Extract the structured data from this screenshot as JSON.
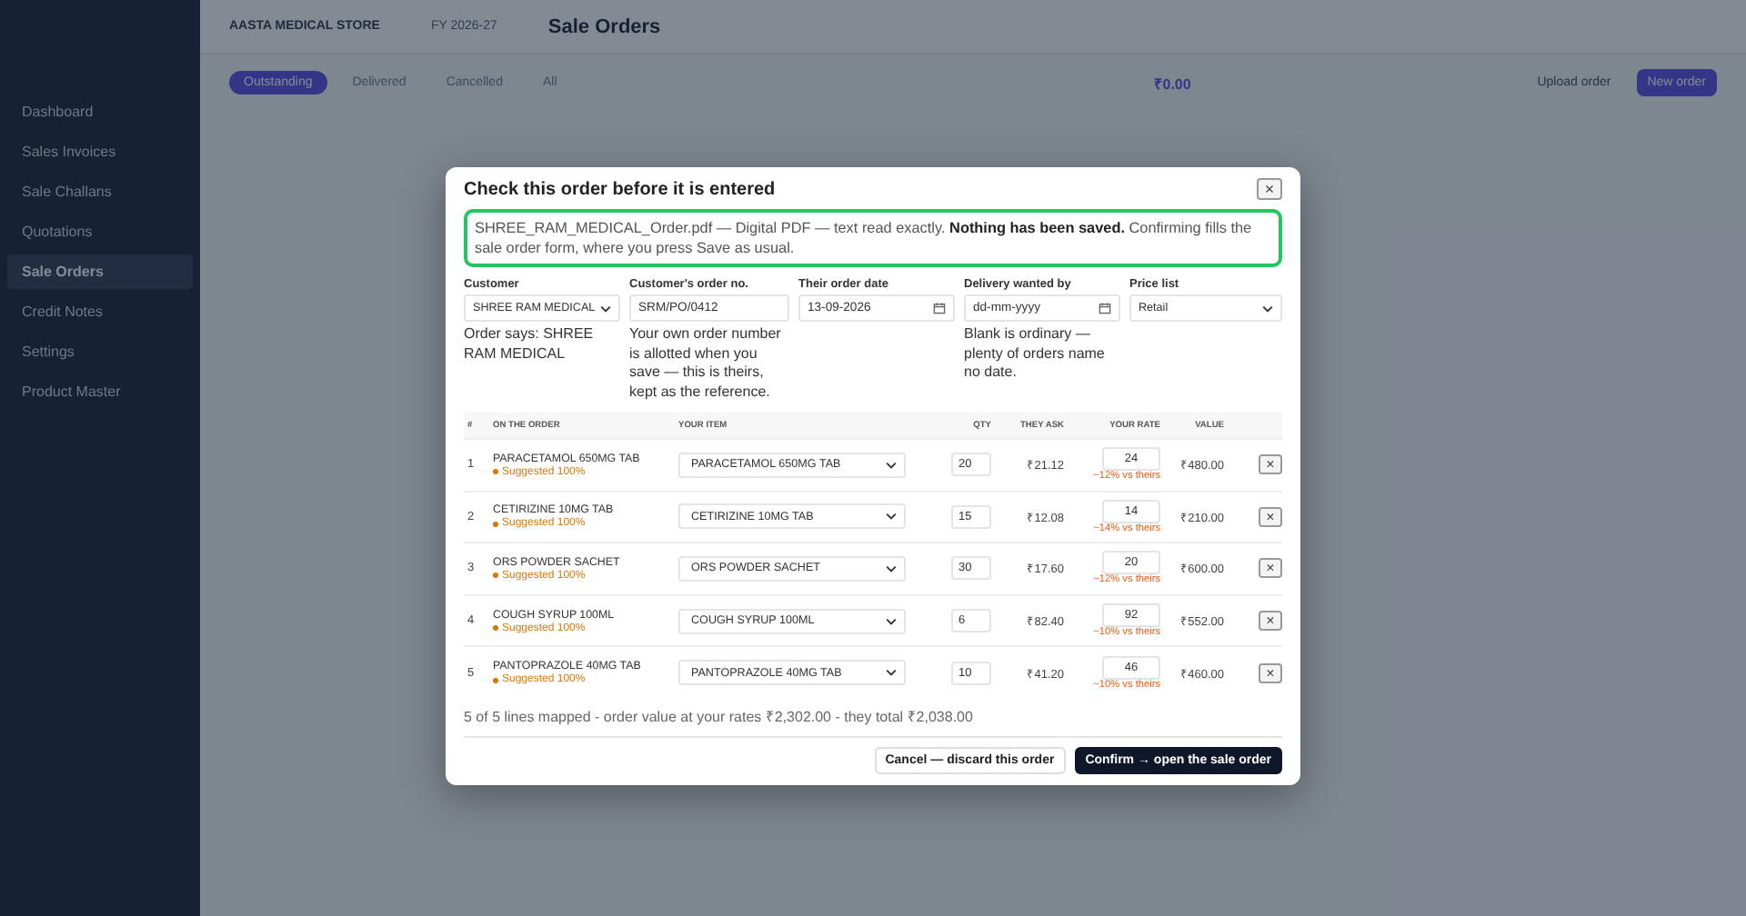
{
  "sidebar": {
    "items": [
      {
        "label": "Dashboard",
        "selected": false
      },
      {
        "label": "Sales Invoices",
        "selected": false
      },
      {
        "label": "Sale Challans",
        "selected": false
      },
      {
        "label": "Quotations",
        "selected": false
      },
      {
        "label": "Sale Orders",
        "selected": true
      },
      {
        "label": "Credit Notes",
        "selected": false
      },
      {
        "label": "Settings",
        "selected": false
      },
      {
        "label": "Product Master",
        "selected": false
      }
    ]
  },
  "topbar": {
    "store": "AASTA MEDICAL STORE",
    "year": "FY 2026-27",
    "title": "Sale Orders"
  },
  "tabs": [
    {
      "label": "Outstanding",
      "selected": true
    },
    {
      "label": "Delivered",
      "selected": false
    },
    {
      "label": "Cancelled",
      "selected": false
    },
    {
      "label": "All",
      "selected": false
    }
  ],
  "summary_value": "₹0.00",
  "actions": [
    "Upload order",
    "New order"
  ],
  "dialog": {
    "title": "Check this order before it is entered",
    "close": "×",
    "notice": "SHREE_RAM_MEDICAL_Order.pdf — Digital PDF — text read exactly. **Nothing has been saved.** Confirming fills the sale order form, where you press Save as usual.",
    "fields": [
      {
        "kind": "select",
        "label": "Customer",
        "value": "SHREE RAM MEDICAL",
        "help": "Order says: SHREE RAM MEDICAL"
      },
      {
        "kind": "text",
        "label": "Customer's order no.",
        "value": "SRM/PO/0412",
        "help": "Your own order number is allotted when you save — this is theirs, kept as the reference."
      },
      {
        "kind": "date",
        "label": "Their order date",
        "value": "13-09-2026"
      },
      {
        "kind": "date",
        "label": "Delivery wanted by",
        "placeholder": "dd-mm-yyyy",
        "help": "Blank is ordinary — plenty of orders name no date."
      },
      {
        "kind": "select",
        "label": "Price list",
        "value": "Retail"
      }
    ],
    "columns": [
      "#",
      "ON THE ORDER",
      "YOUR ITEM",
      "QTY",
      "THEY ASK",
      "YOUR RATE",
      "VALUE"
    ],
    "rows": [
      {
        "no": "1",
        "order_item": "PARACETAMOL 650MG TAB",
        "match": "Suggested 100%",
        "item": "PARACETAMOL 650MG TAB",
        "qty": "20",
        "ask": "₹21.12",
        "rate": "24",
        "diff": "~12% vs theirs",
        "value": "₹480.00",
        "remove": "×"
      },
      {
        "no": "2",
        "order_item": "CETIRIZINE 10MG TAB",
        "match": "Suggested 100%",
        "item": "CETIRIZINE 10MG TAB",
        "qty": "15",
        "ask": "₹12.08",
        "rate": "14",
        "diff": "~14% vs theirs",
        "value": "₹210.00",
        "remove": "×"
      },
      {
        "no": "3",
        "order_item": "ORS POWDER SACHET",
        "match": "Suggested 100%",
        "item": "ORS POWDER SACHET",
        "qty": "30",
        "ask": "₹17.60",
        "rate": "20",
        "diff": "~12% vs theirs",
        "value": "₹600.00",
        "remove": "×"
      },
      {
        "no": "4",
        "order_item": "COUGH SYRUP 100ML",
        "match": "Suggested 100%",
        "item": "COUGH SYRUP 100ML",
        "qty": "6",
        "ask": "₹82.40",
        "rate": "92",
        "diff": "~10% vs theirs",
        "value": "₹552.00",
        "remove": "×"
      },
      {
        "no": "5",
        "order_item": "PANTOPRAZOLE 40MG TAB",
        "match": "Suggested 100%",
        "item": "PANTOPRAZOLE 40MG TAB",
        "qty": "10",
        "ask": "₹41.20",
        "rate": "46",
        "diff": "~10% vs theirs",
        "value": "₹460.00",
        "remove": "×"
      }
    ],
    "total_line": "5 of 5 lines mapped - order value at your rates ₹2,302.00 - they total ₹2,038.00",
    "buttons": [
      {
        "kind": "secondary",
        "label": "Cancel — discard this order"
      },
      {
        "kind": "primary",
        "label": "Confirm → open the sale order"
      }
    ]
  }
}
